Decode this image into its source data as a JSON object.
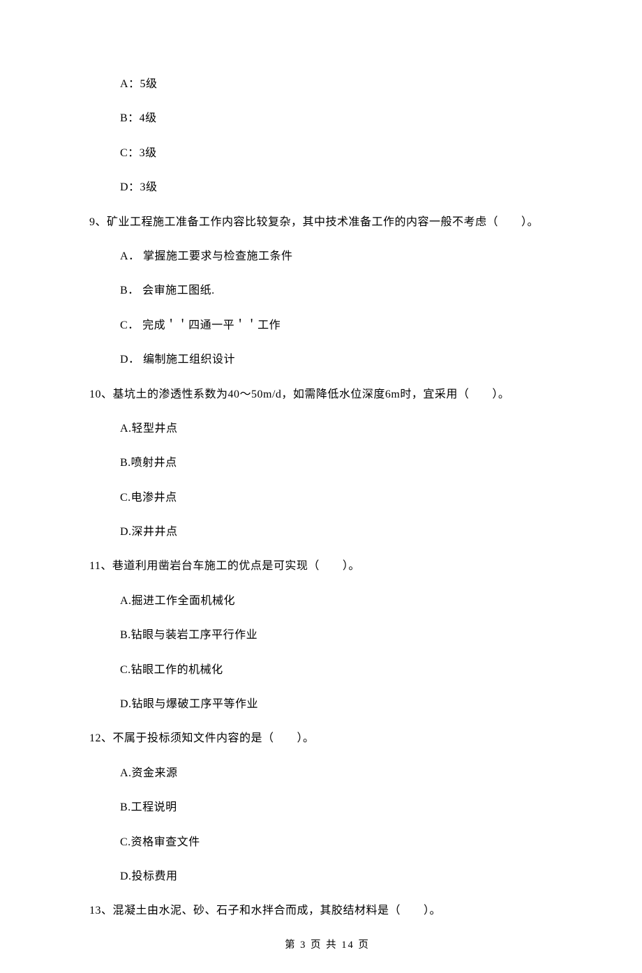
{
  "prev_options": {
    "a": "A：5级",
    "b": "B：4级",
    "c": "C：3级",
    "d": "D：3级"
  },
  "q9": {
    "stem": "9、矿业工程施工准备工作内容比较复杂，其中技术准备工作的内容一般不考虑（　　）。",
    "a": "A． 掌握施工要求与检查施工条件",
    "b": "B． 会审施工图纸.",
    "c": "C． 完成＇＇四通一平＇＇工作",
    "d": "D． 编制施工组织设计"
  },
  "q10": {
    "stem": "10、基坑土的渗透性系数为40～50m/d，如需降低水位深度6m时，宜采用（　　）。",
    "a": "A.轻型井点",
    "b": "B.喷射井点",
    "c": "C.电渗井点",
    "d": "D.深井井点"
  },
  "q11": {
    "stem": "11、巷道利用凿岩台车施工的优点是可实现（　　）。",
    "a": "A.掘进工作全面机械化",
    "b": "B.钻眼与装岩工序平行作业",
    "c": "C.钻眼工作的机械化",
    "d": "D.钻眼与爆破工序平等作业"
  },
  "q12": {
    "stem": "12、不属于投标须知文件内容的是（　　）。",
    "a": "A.资金来源",
    "b": "B.工程说明",
    "c": "C.资格审查文件",
    "d": "D.投标费用"
  },
  "q13": {
    "stem": "13、混凝土由水泥、砂、石子和水拌合而成，其胶结材料是（　　）。"
  },
  "footer": "第 3 页 共 14 页"
}
